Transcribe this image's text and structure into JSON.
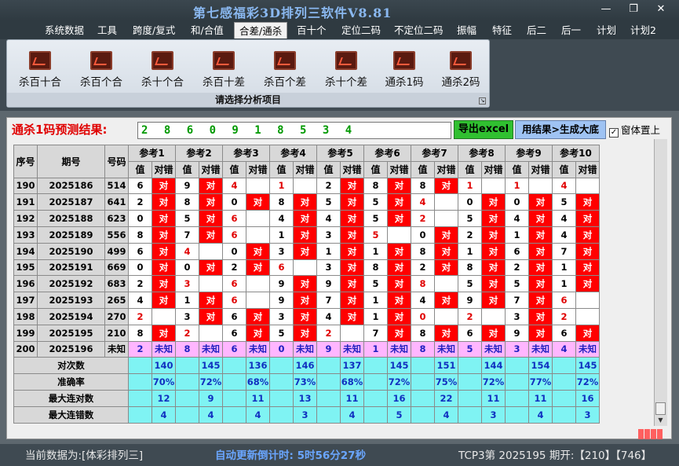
{
  "window": {
    "title": "第七感福彩3D排列三软件V8.81",
    "minimize": "—",
    "restore": "❐",
    "close": "✕"
  },
  "menu": [
    "系统数据",
    "工具",
    "跨度/复式",
    "和/合值",
    "合差/通杀",
    "百十个",
    "定位二码",
    "不定位二码",
    "振幅",
    "特征",
    "后二",
    "后一",
    "计划",
    "计划2"
  ],
  "menu_active": "合差/通杀",
  "ribbon": {
    "buttons": [
      "杀百十合",
      "杀百个合",
      "杀十个合",
      "杀百十差",
      "杀百个差",
      "杀十个差",
      "通杀1码",
      "通杀2码"
    ],
    "caption": "请选择分析项目",
    "corner": "↘"
  },
  "result": {
    "label": "通杀1码预测结果:",
    "value": "2 8 6 0 9 1 8 5 3 4"
  },
  "export_label": "导出excel",
  "generate_label": "用结果>生成大底",
  "topmost": {
    "label": "窗体置上",
    "checked": "✓"
  },
  "table": {
    "col_index": "序号",
    "col_issue": "期号",
    "col_number": "号码",
    "refs": [
      "参考1",
      "参考2",
      "参考3",
      "参考4",
      "参考5",
      "参考6",
      "参考7",
      "参考8",
      "参考9",
      "参考10"
    ],
    "sub_value": "值",
    "sub_result": "对错",
    "rows": [
      {
        "idx": "190",
        "issue": "2025186",
        "num": "514",
        "cells": [
          [
            "6",
            "对"
          ],
          [
            "9",
            "对"
          ],
          [
            "4",
            ""
          ],
          [
            "1",
            ""
          ],
          [
            "2",
            "对"
          ],
          [
            "8",
            "对"
          ],
          [
            "8",
            "对"
          ],
          [
            "1",
            ""
          ],
          [
            "1",
            ""
          ],
          [
            "4",
            ""
          ]
        ]
      },
      {
        "idx": "191",
        "issue": "2025187",
        "num": "641",
        "cells": [
          [
            "2",
            "对"
          ],
          [
            "8",
            "对"
          ],
          [
            "0",
            "对"
          ],
          [
            "8",
            "对"
          ],
          [
            "5",
            "对"
          ],
          [
            "5",
            "对"
          ],
          [
            "4",
            ""
          ],
          [
            "0",
            "对"
          ],
          [
            "0",
            "对"
          ],
          [
            "5",
            "对"
          ]
        ]
      },
      {
        "idx": "192",
        "issue": "2025188",
        "num": "623",
        "cells": [
          [
            "0",
            "对"
          ],
          [
            "5",
            "对"
          ],
          [
            "6",
            ""
          ],
          [
            "4",
            "对"
          ],
          [
            "4",
            "对"
          ],
          [
            "5",
            "对"
          ],
          [
            "2",
            ""
          ],
          [
            "5",
            "对"
          ],
          [
            "4",
            "对"
          ],
          [
            "4",
            "对"
          ]
        ]
      },
      {
        "idx": "193",
        "issue": "2025189",
        "num": "556",
        "cells": [
          [
            "8",
            "对"
          ],
          [
            "7",
            "对"
          ],
          [
            "6",
            ""
          ],
          [
            "1",
            "对"
          ],
          [
            "3",
            "对"
          ],
          [
            "5",
            ""
          ],
          [
            "0",
            "对"
          ],
          [
            "2",
            "对"
          ],
          [
            "1",
            "对"
          ],
          [
            "4",
            "对"
          ]
        ]
      },
      {
        "idx": "194",
        "issue": "2025190",
        "num": "499",
        "cells": [
          [
            "6",
            "对"
          ],
          [
            "4",
            ""
          ],
          [
            "0",
            "对"
          ],
          [
            "3",
            "对"
          ],
          [
            "1",
            "对"
          ],
          [
            "1",
            "对"
          ],
          [
            "8",
            "对"
          ],
          [
            "1",
            "对"
          ],
          [
            "6",
            "对"
          ],
          [
            "7",
            "对"
          ]
        ]
      },
      {
        "idx": "195",
        "issue": "2025191",
        "num": "669",
        "cells": [
          [
            "0",
            "对"
          ],
          [
            "0",
            "对"
          ],
          [
            "2",
            "对"
          ],
          [
            "6",
            ""
          ],
          [
            "3",
            "对"
          ],
          [
            "8",
            "对"
          ],
          [
            "2",
            "对"
          ],
          [
            "8",
            "对"
          ],
          [
            "2",
            "对"
          ],
          [
            "1",
            "对"
          ]
        ]
      },
      {
        "idx": "196",
        "issue": "2025192",
        "num": "683",
        "cells": [
          [
            "2",
            "对"
          ],
          [
            "3",
            ""
          ],
          [
            "6",
            ""
          ],
          [
            "9",
            "对"
          ],
          [
            "9",
            "对"
          ],
          [
            "5",
            "对"
          ],
          [
            "8",
            ""
          ],
          [
            "5",
            "对"
          ],
          [
            "5",
            "对"
          ],
          [
            "1",
            "对"
          ]
        ]
      },
      {
        "idx": "197",
        "issue": "2025193",
        "num": "265",
        "cells": [
          [
            "4",
            "对"
          ],
          [
            "1",
            "对"
          ],
          [
            "6",
            ""
          ],
          [
            "9",
            "对"
          ],
          [
            "7",
            "对"
          ],
          [
            "1",
            "对"
          ],
          [
            "4",
            "对"
          ],
          [
            "9",
            "对"
          ],
          [
            "7",
            "对"
          ],
          [
            "6",
            ""
          ]
        ]
      },
      {
        "idx": "198",
        "issue": "2025194",
        "num": "270",
        "cells": [
          [
            "2",
            ""
          ],
          [
            "3",
            "对"
          ],
          [
            "6",
            "对"
          ],
          [
            "3",
            "对"
          ],
          [
            "4",
            "对"
          ],
          [
            "1",
            "对"
          ],
          [
            "0",
            ""
          ],
          [
            "2",
            ""
          ],
          [
            "3",
            "对"
          ],
          [
            "2",
            ""
          ]
        ]
      },
      {
        "idx": "199",
        "issue": "2025195",
        "num": "210",
        "cells": [
          [
            "8",
            "对"
          ],
          [
            "2",
            ""
          ],
          [
            "6",
            "对"
          ],
          [
            "5",
            "对"
          ],
          [
            "2",
            ""
          ],
          [
            "7",
            "对"
          ],
          [
            "8",
            "对"
          ],
          [
            "6",
            "对"
          ],
          [
            "9",
            "对"
          ],
          [
            "6",
            "对"
          ]
        ]
      }
    ],
    "pred_row": {
      "idx": "200",
      "issue": "2025196",
      "num": "未知",
      "cells": [
        [
          "2",
          "未知"
        ],
        [
          "8",
          "未知"
        ],
        [
          "6",
          "未知"
        ],
        [
          "0",
          "未知"
        ],
        [
          "9",
          "未知"
        ],
        [
          "1",
          "未知"
        ],
        [
          "8",
          "未知"
        ],
        [
          "5",
          "未知"
        ],
        [
          "3",
          "未知"
        ],
        [
          "4",
          "未知"
        ]
      ]
    },
    "stats": [
      {
        "label": "对次数",
        "values": [
          "140",
          "145",
          "136",
          "146",
          "137",
          "145",
          "151",
          "144",
          "154",
          "145"
        ]
      },
      {
        "label": "准确率",
        "values": [
          "70%",
          "72%",
          "68%",
          "73%",
          "68%",
          "72%",
          "75%",
          "72%",
          "77%",
          "72%"
        ]
      },
      {
        "label": "最大连对数",
        "values": [
          "12",
          "9",
          "11",
          "13",
          "11",
          "16",
          "22",
          "11",
          "11",
          "16"
        ]
      },
      {
        "label": "最大连错数",
        "values": [
          "4",
          "4",
          "4",
          "3",
          "4",
          "5",
          "4",
          "3",
          "4",
          "3"
        ]
      }
    ]
  },
  "status": {
    "data_source": "当前数据为:[体彩排列三]",
    "countdown": "自动更新倒计时: 5时56分27秒",
    "tcp": "TCP3第 2025195 期开:【210】【746】"
  },
  "colors": {
    "hit": "#ff0000",
    "pred": "#ffb6ff",
    "stat": "#7ff3f3",
    "result_green": "#009900"
  }
}
